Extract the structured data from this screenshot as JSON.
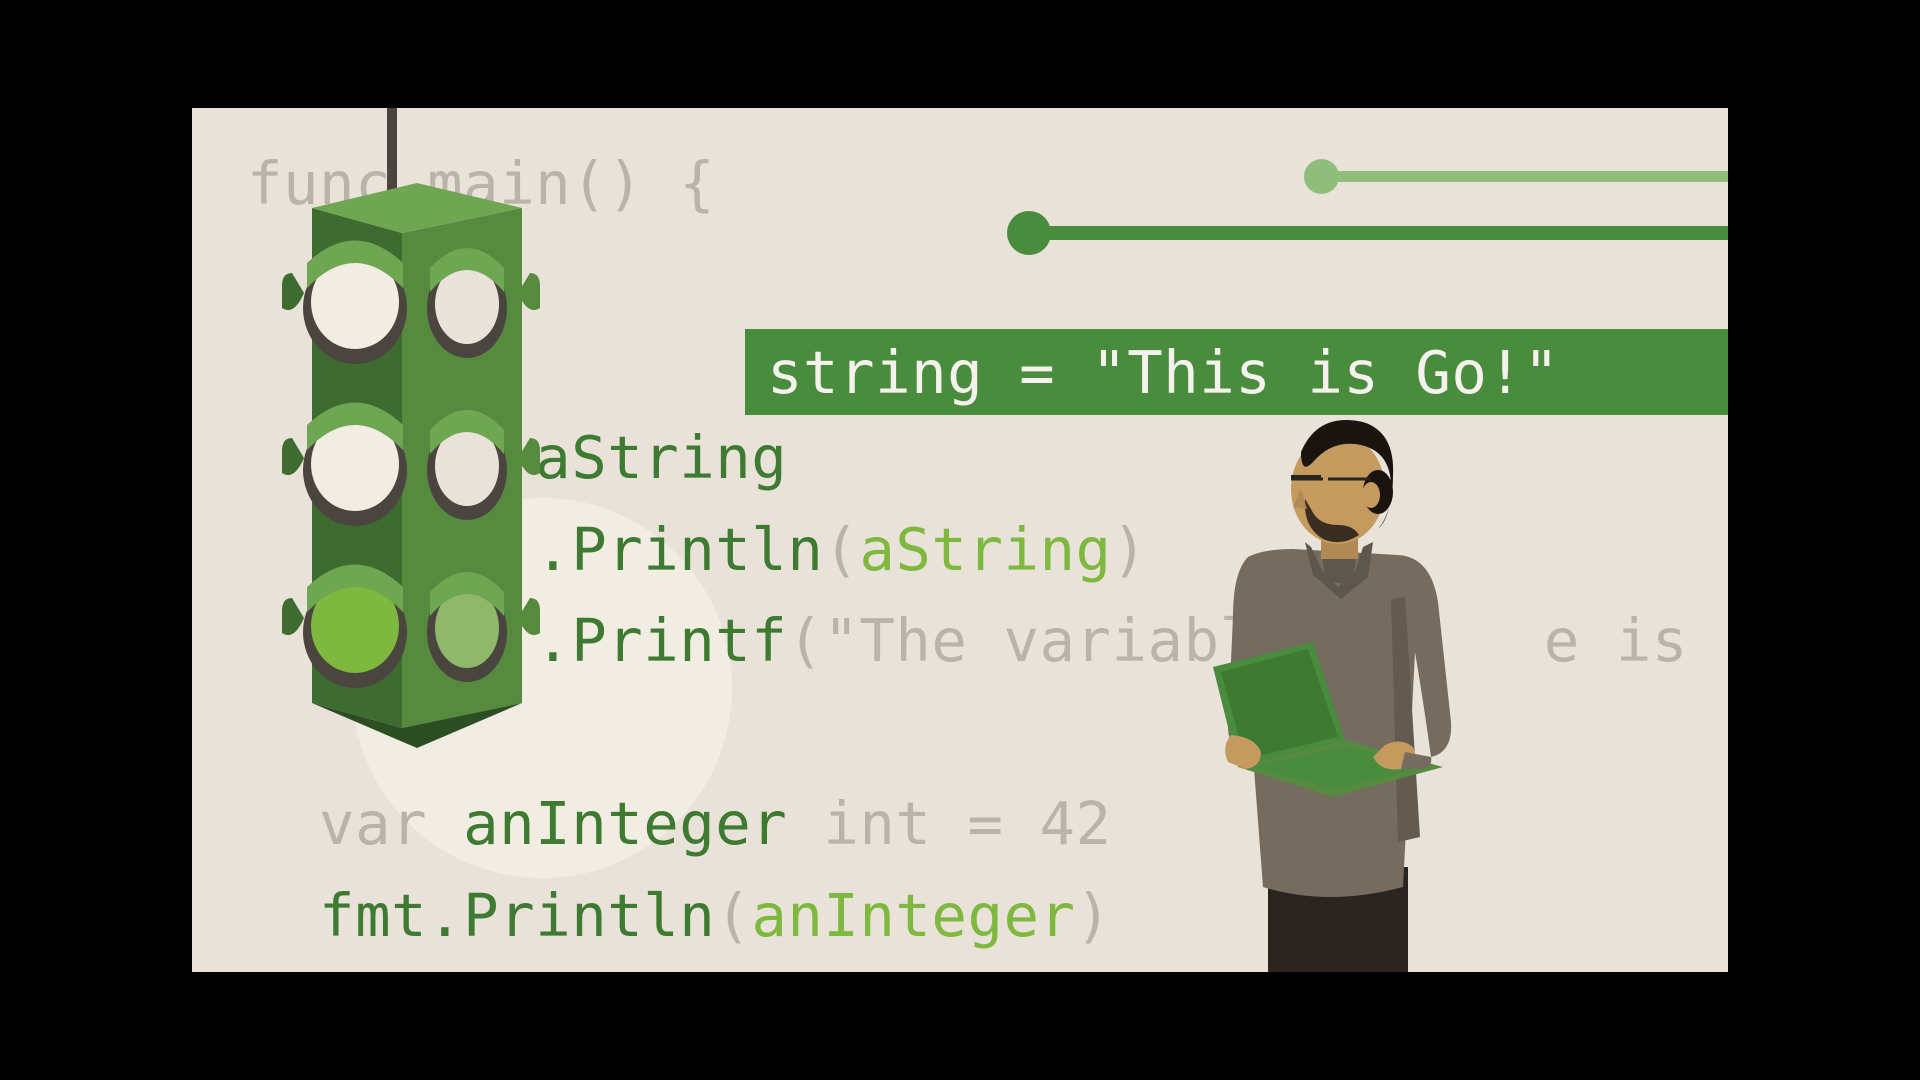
{
  "code": {
    "line1": "func main() {",
    "line2_var": "aString",
    "line2_highlight": "string = \"This is Go!\"",
    "line3_pkg": "",
    "line3_func": ".Println",
    "line3_param": "aString",
    "line4_func": ".Printf",
    "line4_str": "\"The variable's     e is",
    "line5_prefix": "var ",
    "line5_var": "anInteger",
    "line5_suffix": " int = 42",
    "line6_pkg": "fmt",
    "line6_func": ".Println",
    "line6_param": "anInteger"
  },
  "colors": {
    "bg": "#e8e2d9",
    "dim": "#bab3a8",
    "green_dark": "#3e7a32",
    "green_mid": "#4a8c3e",
    "green_light": "#7fb83f",
    "white": "#f5f2ed"
  }
}
